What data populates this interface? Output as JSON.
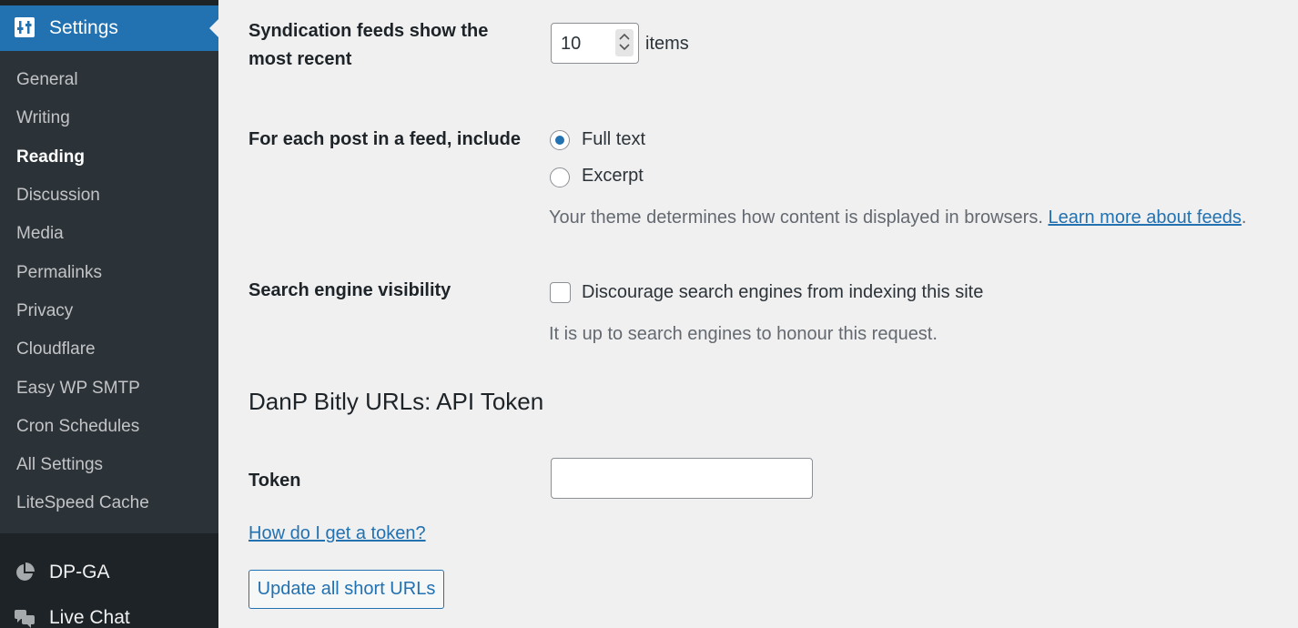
{
  "sidebar": {
    "current": {
      "label": "Settings",
      "icon": "settings-sliders-icon"
    },
    "submenu": [
      "General",
      "Writing",
      "Reading",
      "Discussion",
      "Media",
      "Permalinks",
      "Privacy",
      "Cloudflare",
      "Easy WP SMTP",
      "Cron Schedules",
      "All Settings",
      "LiteSpeed Cache"
    ],
    "current_submenu": "Reading",
    "menu": [
      {
        "label": "DP-GA",
        "icon": "pie-chart-icon"
      },
      {
        "label": "Live Chat",
        "icon": "chat-bubbles-icon"
      }
    ]
  },
  "feeds": {
    "label": "Syndication feeds show the most recent",
    "label_line1": "Syndication feeds show the",
    "label_line2": "most recent",
    "value": "10",
    "suffix": "items"
  },
  "feed_content": {
    "label": "For each post in a feed, include",
    "options": [
      "Full text",
      "Excerpt"
    ],
    "selected": "Full text",
    "description": "Your theme determines how content is displayed in browsers.",
    "link": "Learn more about feeds",
    "period": "."
  },
  "visibility": {
    "label": "Search engine visibility",
    "checkbox_label": "Discourage search engines from indexing this site",
    "checked": false,
    "description": "It is up to search engines to honour this request."
  },
  "bitly": {
    "heading": "DanP Bitly URLs: API Token",
    "token_label": "Token",
    "token_value": "",
    "help_link": "How do I get a token?",
    "button": "Update all short URLs"
  },
  "colors": {
    "accent": "#2271b1",
    "sidebar_bg": "#1d2327",
    "submenu_bg": "#2c3338",
    "page_bg": "#f0f0f1"
  }
}
